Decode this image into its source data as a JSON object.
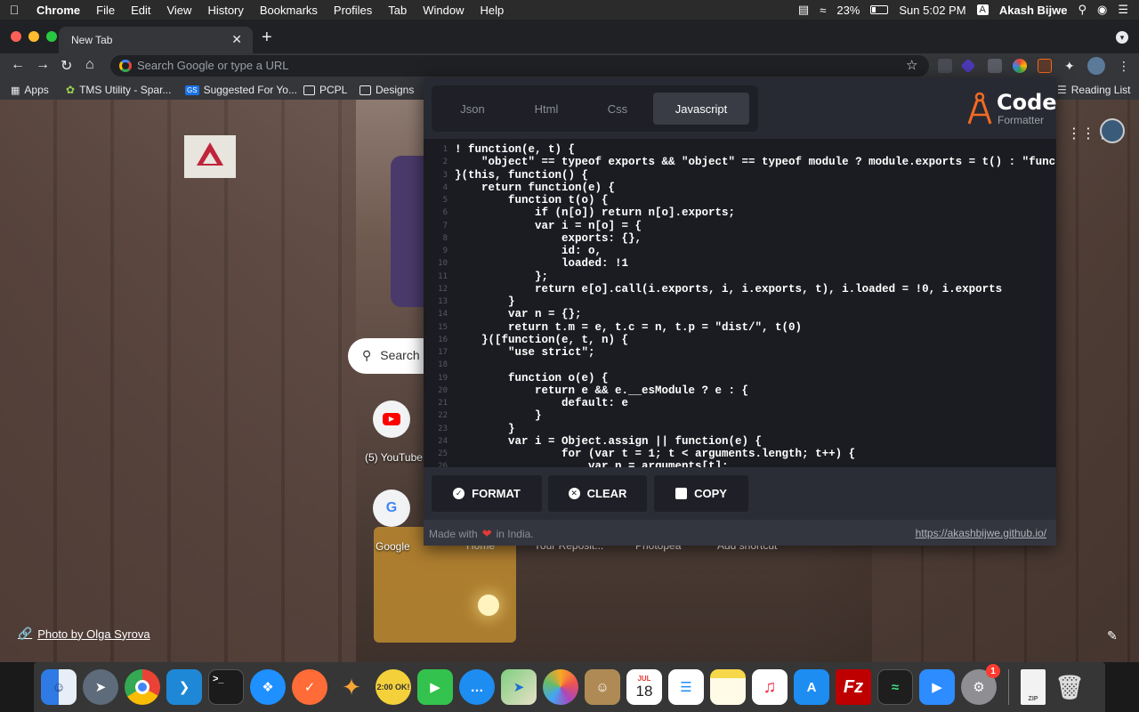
{
  "menubar": {
    "app": "Chrome",
    "items": [
      "File",
      "Edit",
      "View",
      "History",
      "Bookmarks",
      "Profiles",
      "Tab",
      "Window",
      "Help"
    ],
    "battery": "23%",
    "clock": "Sun 5:02 PM",
    "user": "Akash Bijwe"
  },
  "browser": {
    "tab_title": "New Tab",
    "omnibox_placeholder": "Search Google or type a URL",
    "bookmarks": [
      "Apps",
      "TMS Utility - Spar...",
      "Suggested For Yo...",
      "PCPL",
      "Designs"
    ],
    "reading_list": "Reading List"
  },
  "newtab": {
    "search_text": "Search",
    "shortcuts": [
      "(5) YouTube",
      "Google"
    ],
    "hidden_shortcuts": [
      "Home",
      "Your Reposit...",
      "Photopea",
      "Add shortcut"
    ],
    "photo_credit": "Photo by Olga Syrova"
  },
  "popup": {
    "tabs": [
      {
        "label": "Json",
        "active": false
      },
      {
        "label": "Html",
        "active": false
      },
      {
        "label": "Css",
        "active": false
      },
      {
        "label": "Javascript",
        "active": true
      }
    ],
    "logo_title": "Code",
    "logo_subtitle": "Formatter",
    "code_lines": [
      "! function(e, t) {",
      "    \"object\" == typeof exports && \"object\" == typeof module ? module.exports = t() : \"function\"",
      "}(this, function() {",
      "    return function(e) {",
      "        function t(o) {",
      "            if (n[o]) return n[o].exports;",
      "            var i = n[o] = {",
      "                exports: {},",
      "                id: o,",
      "                loaded: !1",
      "            };",
      "            return e[o].call(i.exports, i, i.exports, t), i.loaded = !0, i.exports",
      "        }",
      "        var n = {};",
      "        return t.m = e, t.c = n, t.p = \"dist/\", t(0)",
      "    }([function(e, t, n) {",
      "        \"use strict\";",
      "",
      "        function o(e) {",
      "            return e && e.__esModule ? e : {",
      "                default: e",
      "            }",
      "        }",
      "        var i = Object.assign || function(e) {",
      "                for (var t = 1; t < arguments.length; t++) {",
      "                    var n = arguments[t];"
    ],
    "line_numbers": [
      "1",
      "2",
      "3",
      "4",
      "5",
      "6",
      "7",
      "8",
      "9",
      "10",
      "11",
      "12",
      "13",
      "14",
      "15",
      "16",
      "17",
      "18",
      "19",
      "20",
      "21",
      "22",
      "23",
      "24",
      "25",
      "26"
    ],
    "buttons": {
      "format": "FORMAT",
      "clear": "CLEAR",
      "copy": "COPY"
    },
    "footer": {
      "made_with": "Made with",
      "in_india": "in India.",
      "url": "https://akashbijwe.github.io/"
    }
  },
  "dock": {
    "calendar_month": "JUL",
    "calendar_day": "18",
    "mail_badge": "1",
    "ok_label": "2:00 OK!"
  }
}
